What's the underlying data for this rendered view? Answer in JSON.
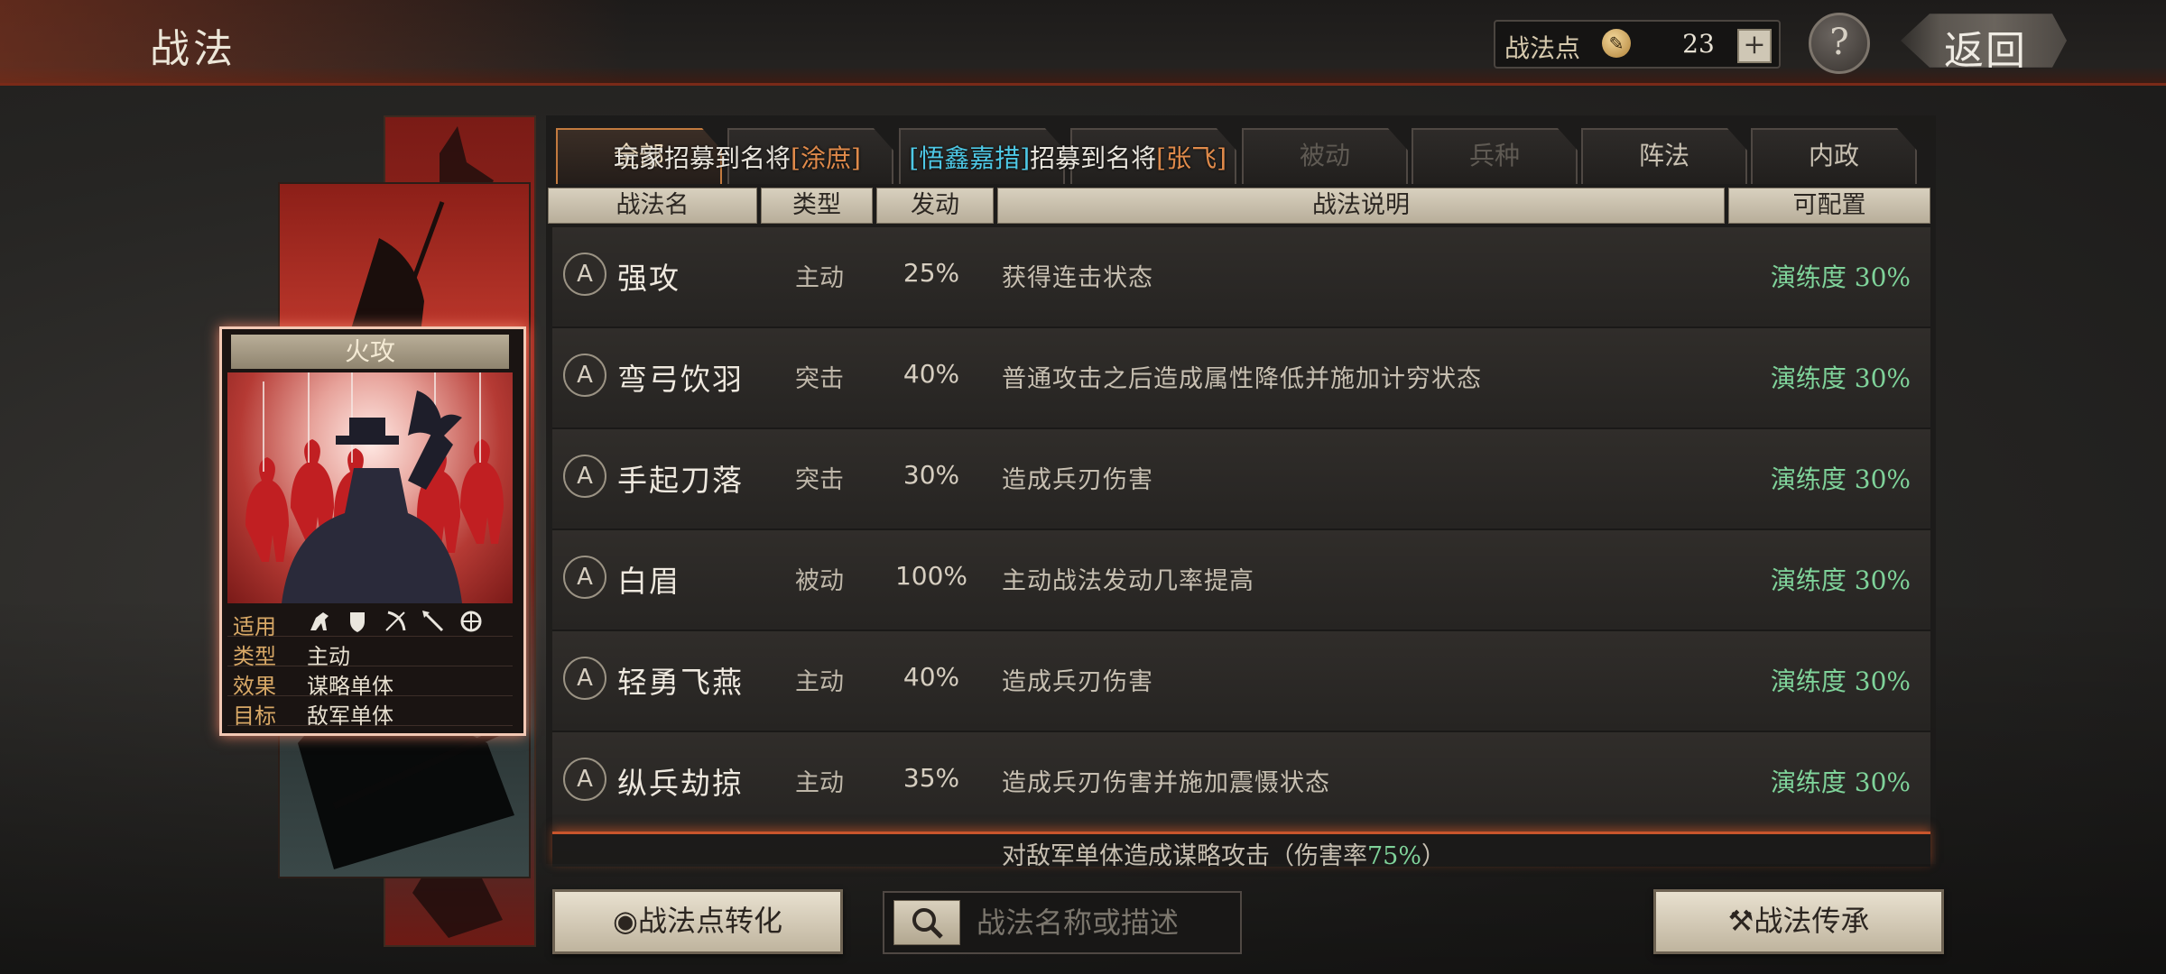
{
  "header": {
    "title": "战法",
    "points_label": "战法点",
    "points_value": "23",
    "plus_label": "+",
    "help_label": "?",
    "back_label": "返回"
  },
  "tabs": [
    {
      "label": "全部",
      "active": true
    },
    {
      "label": "",
      "active": false
    },
    {
      "label": "",
      "active": false
    },
    {
      "label": "",
      "active": false
    },
    {
      "label": "被动",
      "active": false
    },
    {
      "label": "兵种",
      "active": false
    },
    {
      "label": "阵法",
      "active": false
    },
    {
      "label": "内政",
      "active": false
    }
  ],
  "ticker": {
    "part1": "玩家",
    "part2": "招募到名将",
    "part3": "[涂庶]",
    "part4": "[悟鑫嘉措]",
    "part5": "招募到名将",
    "part6": "[张飞]"
  },
  "table_headers": {
    "name": "战法名",
    "type": "类型",
    "rate": "发动",
    "desc": "战法说明",
    "config": "可配置"
  },
  "tactics": [
    {
      "grade": "A",
      "name": "强攻",
      "type": "主动",
      "rate": "25%",
      "desc": "获得连击状态",
      "status": "演练度 30%"
    },
    {
      "grade": "A",
      "name": "弯弓饮羽",
      "type": "突击",
      "rate": "40%",
      "desc": "普通攻击之后造成属性降低并施加计穷状态",
      "status": "演练度 30%"
    },
    {
      "grade": "A",
      "name": "手起刀落",
      "type": "突击",
      "rate": "30%",
      "desc": "造成兵刃伤害",
      "status": "演练度 30%"
    },
    {
      "grade": "A",
      "name": "白眉",
      "type": "被动",
      "rate": "100%",
      "desc": "主动战法发动几率提高",
      "status": "演练度 30%"
    },
    {
      "grade": "A",
      "name": "轻勇飞燕",
      "type": "主动",
      "rate": "40%",
      "desc": "造成兵刃伤害",
      "status": "演练度 30%"
    },
    {
      "grade": "A",
      "name": "纵兵劫掠",
      "type": "主动",
      "rate": "35%",
      "desc": "造成兵刃伤害并施加震慑状态",
      "status": "演练度 30%"
    }
  ],
  "partial_row": {
    "desc": "对敌军单体造成谋略攻击（伤害率",
    "highlight": "75%",
    "desc_end": "）"
  },
  "card": {
    "title": "火攻",
    "rows": [
      {
        "key": "适用",
        "value": ""
      },
      {
        "key": "类型",
        "value": "主动"
      },
      {
        "key": "效果",
        "value": "谋略单体"
      },
      {
        "key": "目标",
        "value": "敌军单体"
      }
    ],
    "troop_icons": [
      "cavalry-icon",
      "shield-icon",
      "bow-icon",
      "spear-icon",
      "wheel-icon"
    ]
  },
  "bottom": {
    "convert_label": "战法点转化",
    "search_placeholder": "战法名称或描述",
    "inherit_label": "战法传承"
  },
  "colors": {
    "status_green": "#7fd39a",
    "highlight_orange": "#e08a4a",
    "highlight_cyan": "#4ec9e6",
    "card_glow": "#f2c8b4"
  }
}
